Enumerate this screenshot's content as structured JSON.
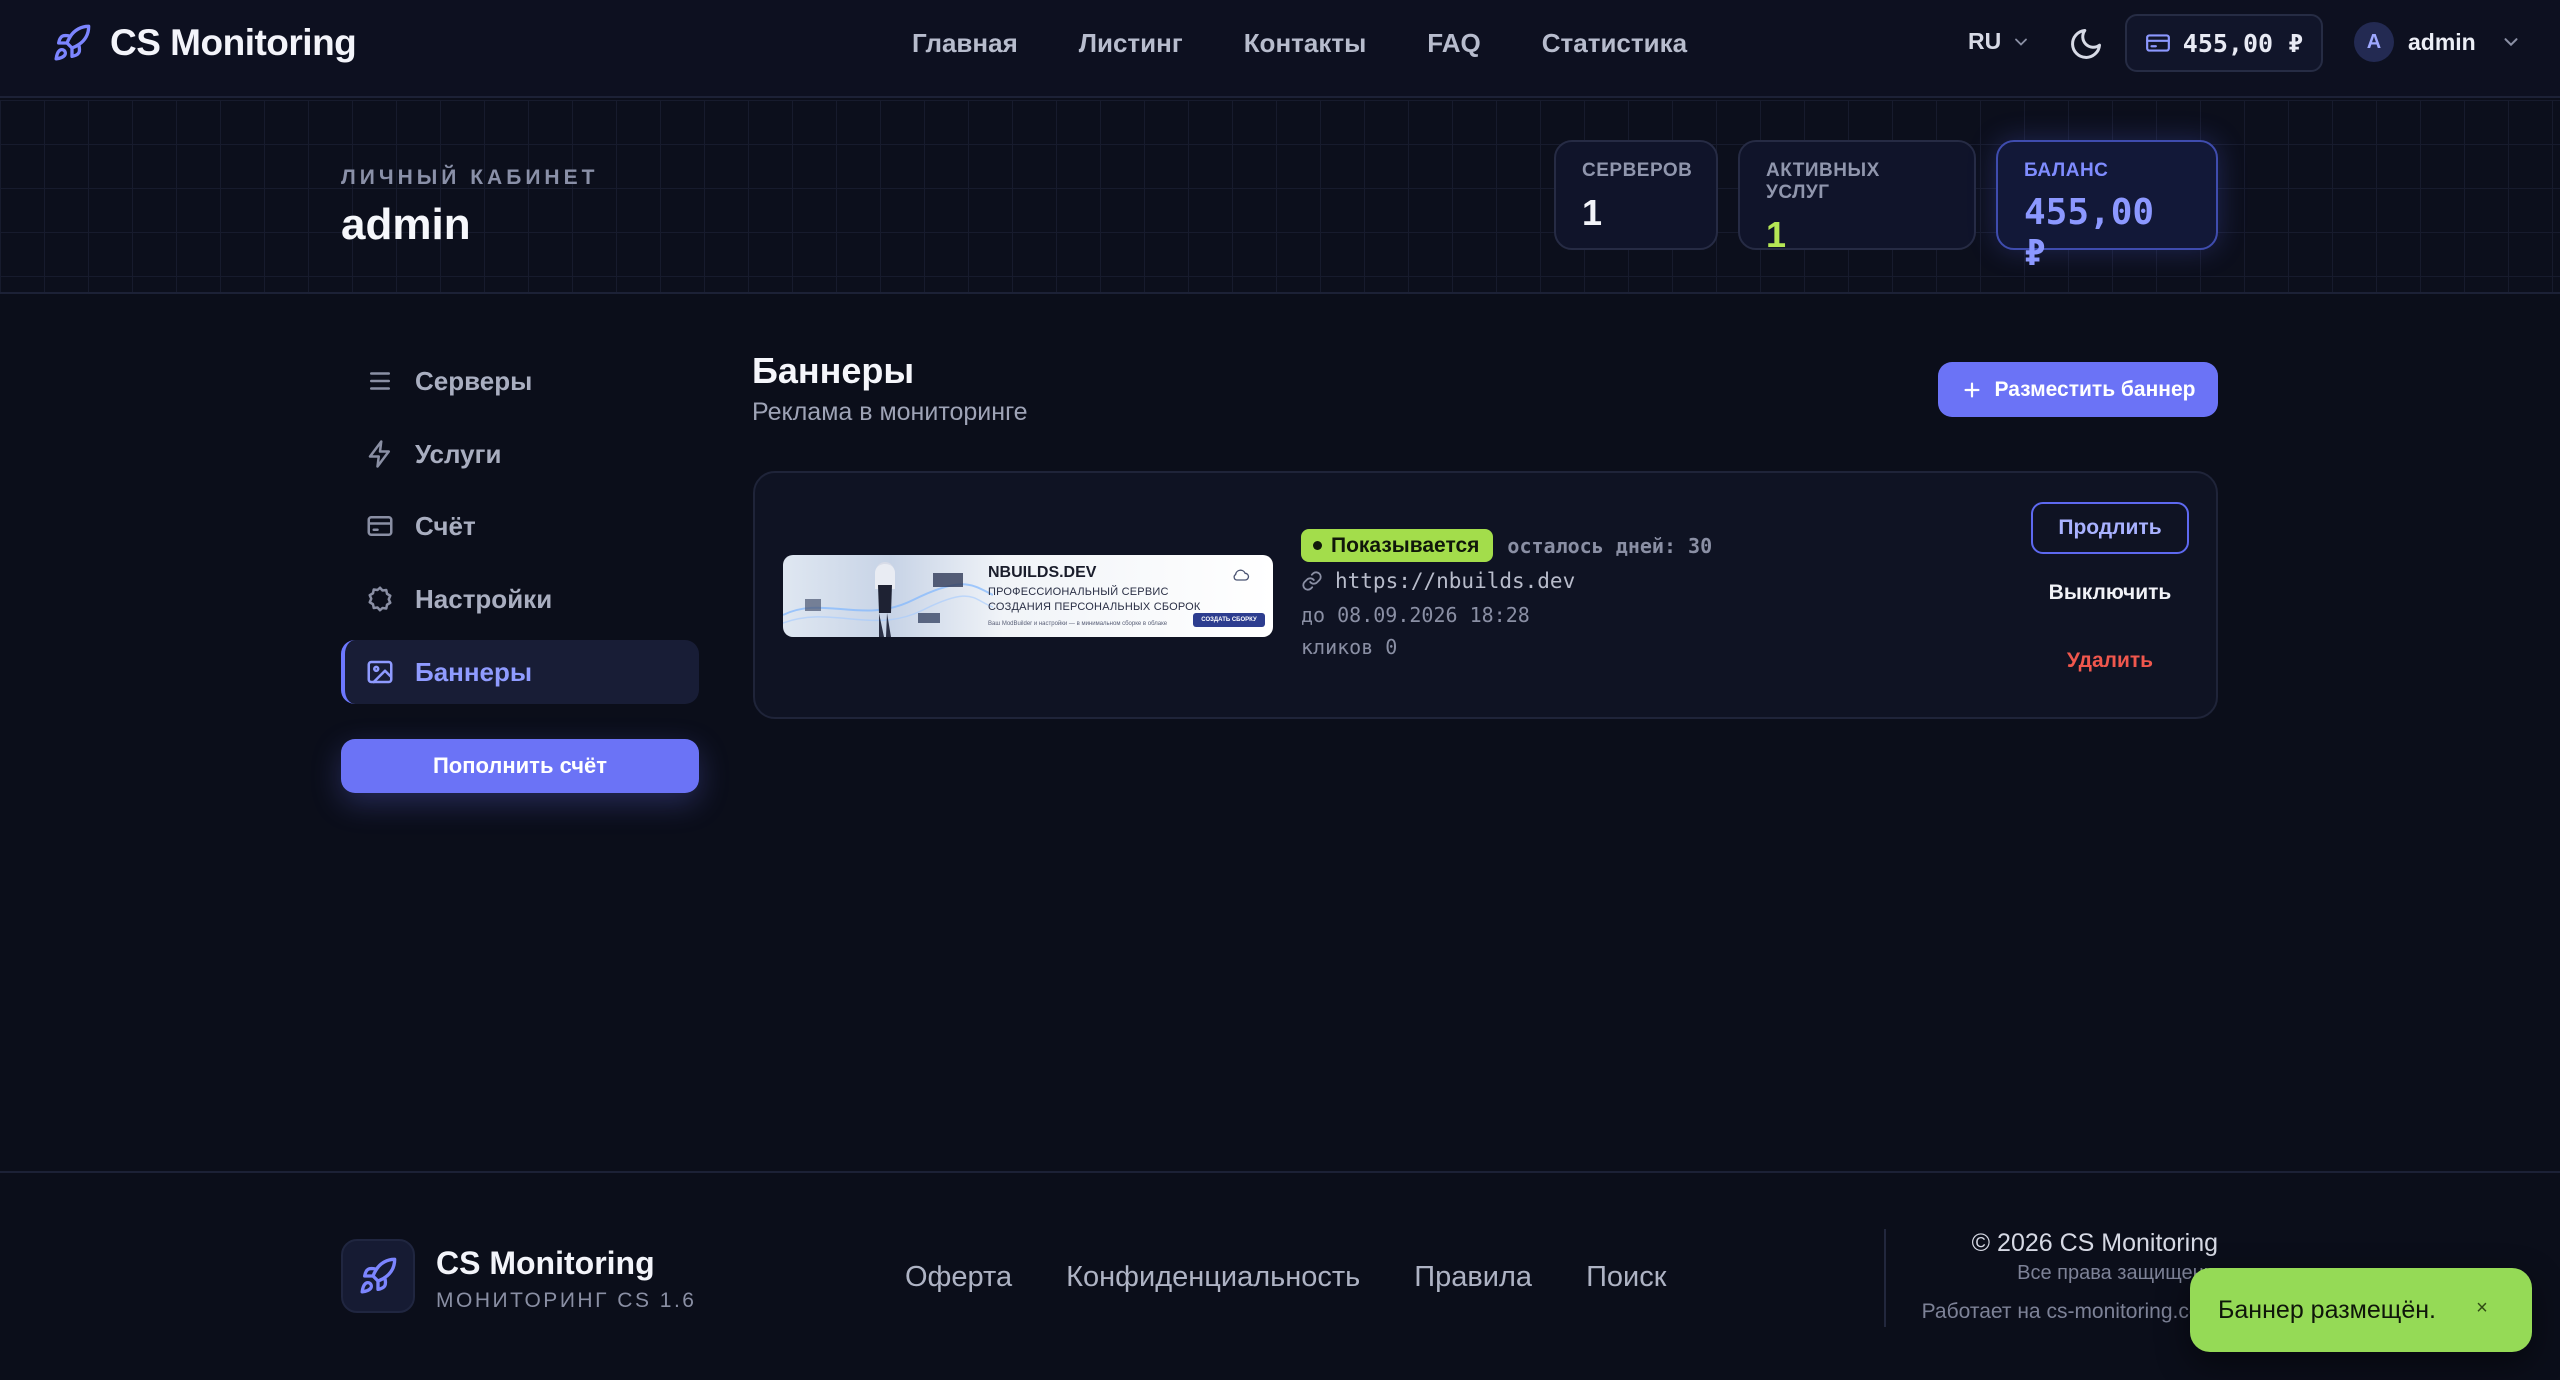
{
  "header": {
    "brand": "CS Monitoring",
    "nav": [
      "Главная",
      "Листинг",
      "Контакты",
      "FAQ",
      "Статистика"
    ],
    "language": "RU",
    "wallet_balance": "455,00 ₽",
    "user": {
      "avatar_letter": "A",
      "name": "admin"
    }
  },
  "hero": {
    "kicker": "ЛИЧНЫЙ КАБИНЕТ",
    "title": "admin",
    "stats": [
      {
        "label": "СЕРВЕРОВ",
        "value": "1"
      },
      {
        "label": "АКТИВНЫХ УСЛУГ",
        "value": "1"
      },
      {
        "label": "БАЛАНС",
        "value": "455,00 ₽"
      }
    ]
  },
  "sidebar": {
    "items": [
      {
        "label": "Серверы",
        "icon": "list-icon"
      },
      {
        "label": "Услуги",
        "icon": "bolt-icon"
      },
      {
        "label": "Счёт",
        "icon": "card-icon"
      },
      {
        "label": "Настройки",
        "icon": "gear-icon"
      },
      {
        "label": "Баннеры",
        "icon": "image-icon",
        "active": true
      }
    ],
    "topup_label": "Пополнить счёт"
  },
  "main": {
    "title": "Баннеры",
    "subtitle": "Реклама в мониторинге",
    "add_button": "Разместить баннер",
    "banner": {
      "image": {
        "title": "NBUILDS.DEV",
        "line1": "ПРОФЕССИОНАЛЬНЫЙ СЕРВИС",
        "line2": "СОЗДАНИЯ ПЕРСОНАЛЬНЫХ СБОРОК",
        "small": "Ваш ModBuilder и настройки — в минимальном сборке в облаке",
        "button": "СОЗДАТЬ СБОРКУ"
      },
      "status": "Показывается",
      "days_left": "осталось дней: 30",
      "url": "https://nbuilds.dev",
      "until": "до 08.09.2026 18:28",
      "clicks": "кликов 0",
      "actions": {
        "extend": "Продлить",
        "disable": "Выключить",
        "delete": "Удалить"
      }
    }
  },
  "footer": {
    "name": "CS Monitoring",
    "tagline": "МОНИТОРИНГ CS 1.6",
    "links": [
      "Оферта",
      "Конфиденциальность",
      "Правила",
      "Поиск"
    ],
    "copyright": "© 2026 CS Monitoring",
    "rights": "Все права защищены",
    "powered": "Работает на cs-monitoring.com"
  },
  "toast": {
    "message": "Баннер размещён.",
    "close": "×"
  },
  "colors": {
    "accent": "#6b73f6",
    "status_green": "#a3dd4b",
    "danger": "#f0574d",
    "background": "#0b0e1a"
  }
}
